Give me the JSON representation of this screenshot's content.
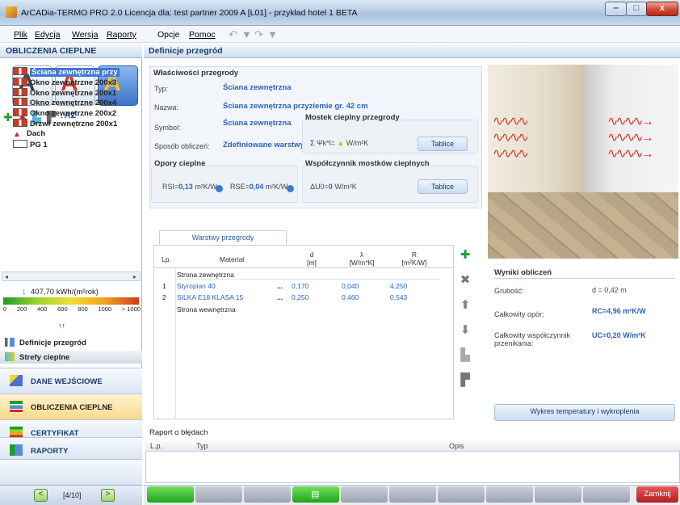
{
  "window": {
    "title": "ArCADia-TERMO PRO 2.0 Licencja dla: test partner 2009 A [L01] - przykład hotel 1 BETA",
    "close_glyph": "x",
    "min_glyph": "–",
    "max_glyph": "□"
  },
  "menu": [
    "Plik",
    "Edycja",
    "Wersja",
    "Raporty",
    "Opcje",
    "Pomoc"
  ],
  "left_header": "OBLICZENIA CIEPLNE",
  "right_header": "Definicje przegród",
  "tree": [
    {
      "label": "Ściana zewnętrzna przy",
      "type": "wall",
      "selected": true
    },
    {
      "label": "Okno zewnętrzne 200x3",
      "type": "window"
    },
    {
      "label": "Okno zewnętrzne 200x1",
      "type": "window"
    },
    {
      "label": "Okno zewnętrzne 200x4",
      "type": "window"
    },
    {
      "label": "Okno zewnętrzne 200x2",
      "type": "window"
    },
    {
      "label": "Drzwi zewnętrzne 200x1",
      "type": "door"
    },
    {
      "label": "Dach",
      "type": "roof"
    },
    {
      "label": "PG 1",
      "type": "floor"
    }
  ],
  "energy": {
    "value": "407,70 kWh/(m²rok)",
    "scale": [
      "0",
      "200",
      "400",
      "600",
      "800",
      "1000",
      "> 1000"
    ]
  },
  "subnav": [
    "Definicje przegród",
    "Strefy cieplne"
  ],
  "sections": [
    "DANE WEJŚCIOWE",
    "OBLICZENIA CIEPLNE",
    "CERTYFIKAT",
    "RAPORTY"
  ],
  "pager": {
    "label": "[4/10]",
    "prev": "<",
    "next": ">"
  },
  "props": {
    "title": "Właściwości przegrody",
    "typ_label": "Typ:",
    "typ_value": "Ściana zewnętrzna",
    "nazwa_label": "Nazwa:",
    "nazwa_value": "Ściana zewnętrzna przyziemie gr. 42 cm",
    "symbol_label": "Symbol:",
    "symbol_value": "Ściana zewnętrzna",
    "metoda_label": "Sposób obliczeń:",
    "metoda_value": "Zdefiniowane warstwy",
    "mostek_title": "Mostek cieplny przegrody",
    "mostek_formula": "Σ Ψk*l=",
    "mostek_unit": "W/m²K",
    "opory_title": "Opory cieplne",
    "rsi": "RSI=",
    "rsi_val": "0,13",
    "rsi_unit": "m²K/W",
    "rse": "RSE=",
    "rse_val": "0,04",
    "rse_unit": "m²K/W",
    "wsp_title": "Współczynnik mostków cieplnych",
    "du_formula": "ΔU0=",
    "du_val": "0",
    "du_unit": "W/m²K",
    "tablice": "Tablice"
  },
  "layers": {
    "tab": "Warstwy przegrody",
    "headers": [
      {
        "top": "",
        "bot": "Lp."
      },
      {
        "top": "",
        "bot": "Materiał"
      },
      {
        "top": "d",
        "bot": "[m]"
      },
      {
        "top": "λ",
        "bot": "[W/m*K]"
      },
      {
        "top": "R",
        "bot": "[m²K/W]"
      }
    ],
    "outside": "Strona zewnętrzna",
    "inside": "Strona wewnętrzna",
    "rows": [
      {
        "lp": "1",
        "material": "Styropian 40",
        "dots": "...",
        "d": "0,170",
        "lambda": "0,040",
        "r": "4,250"
      },
      {
        "lp": "2",
        "material": "SILKA E18 KLASA 15",
        "dots": "...",
        "d": "0,250",
        "lambda": "0,460",
        "r": "0,543"
      }
    ]
  },
  "results": {
    "title": "Wyniki obliczeń",
    "grubosc_label": "Grubość:",
    "grubosc_value": "d = 0,42 m",
    "opor_label": "Całkowity opór:",
    "opor_value": "RC=4,96 m²K/W",
    "u_label": "Całkowity współczynnik przenikania:",
    "u_value": "UC=0,20 W/m²K",
    "chart_button": "Wykres temperatury i wykroplenia"
  },
  "errors": {
    "title": "Raport o błędach",
    "col_lp": "L.p.",
    "col_typ": "Typ",
    "col_opis": "Opis"
  },
  "statusbar": {
    "close": "Zamknij"
  },
  "colors": {
    "accent": "#2a62c0",
    "header": "#1c3c6e",
    "close_red": "#b51d1d",
    "green": "#1ea51a"
  }
}
